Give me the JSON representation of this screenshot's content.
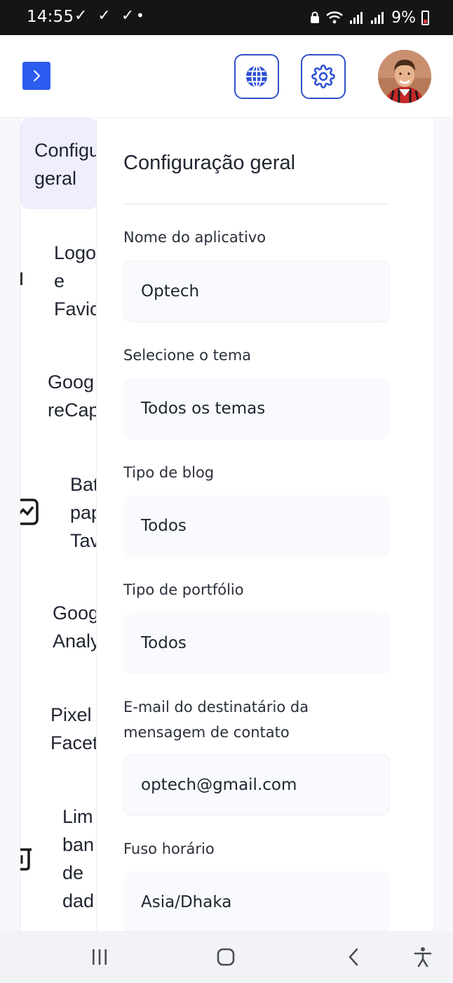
{
  "status_bar": {
    "time": "14:55",
    "checks": "✓ ✓ ✓",
    "dot": "•",
    "wifi": "wifi",
    "battery": "9%"
  },
  "header": {
    "toggle_icon": "chevron-right-icon",
    "language_icon": "globe-icon",
    "settings_icon": "gear-icon",
    "avatar_icon": "user-avatar"
  },
  "sidebar": {
    "items": [
      {
        "label": "Configu\ngeral"
      },
      {
        "label": "Logo\ne\nFavic"
      },
      {
        "label": "Goog\nreCap"
      },
      {
        "label": "Bat\npap\nTav"
      },
      {
        "label": "Goog\nAnaly"
      },
      {
        "label": "Pixel\nFacet"
      },
      {
        "label": "Lim\nban\nde\ndad"
      }
    ]
  },
  "panel": {
    "title": "Configuração geral",
    "fields": [
      {
        "label": "Nome do aplicativo",
        "value": "Optech"
      },
      {
        "label": "Selecione o tema",
        "value": "Todos os temas"
      },
      {
        "label": "Tipo de blog",
        "value": "Todos"
      },
      {
        "label": "Tipo de portfólio",
        "value": "Todos"
      },
      {
        "label": "E-mail do destinatário da\nmensagem de contato",
        "value": "optech@gmail.com"
      },
      {
        "label": "Fuso horário",
        "value": "Asia/Dhaka"
      }
    ]
  },
  "colors": {
    "accent": "#2c5cf0",
    "outline": "#2f50c9",
    "active_bg": "#efeefc"
  }
}
